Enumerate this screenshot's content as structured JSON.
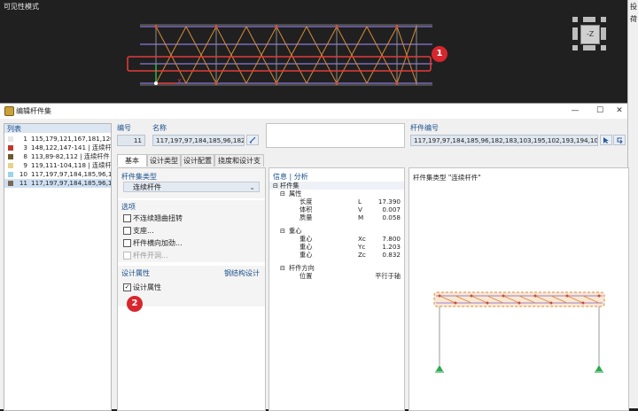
{
  "viewport": {
    "title": "可见性模式",
    "view_cube_label": "-Z",
    "callout1": "1",
    "axis_x": "X"
  },
  "right_strip": {
    "t1": "投",
    "t2": "荷"
  },
  "dialog": {
    "title": "编辑杆件集",
    "win_minimize": "—",
    "win_maximize": "☐",
    "win_close": "✕",
    "list_header": "列表",
    "list": [
      {
        "no": "1",
        "text": "115,179,121,167,181,120,180,9",
        "color": "#e6e6e6"
      },
      {
        "no": "3",
        "text": "148,122,147-141 | 连续杆件",
        "color": "#c0392b"
      },
      {
        "no": "8",
        "text": "113,89-82,112 | 连续杆件",
        "color": "#6b5a2a"
      },
      {
        "no": "9",
        "text": "119,111-104,118 | 连续杆件",
        "color": "#e8d28a"
      },
      {
        "no": "10",
        "text": "117,197,97,184,185,96,182,183,",
        "color": "#9fd3e8"
      },
      {
        "no": "11",
        "text": "117,197,97,184,185,96,182,183,",
        "color": "#7a6a55",
        "selected": true
      }
    ],
    "number_label": "编号",
    "number_value": "11",
    "name_label": "名称",
    "name_value": "117,197,97,184,185,96,182,183,10",
    "members_label": "杆件编号",
    "members_value": "117,197,97,184,185,96,182,183,103,195,102,193,194,101,191,192,100,19",
    "tabs": [
      "基本",
      "设计类型",
      "设计配置",
      "挠度和设计支座"
    ],
    "type_label": "杆件集类型",
    "type_value": "连续杆件",
    "options_label": "选项",
    "options": [
      {
        "label": "不连续翘曲扭转",
        "checked": false,
        "disabled": false
      },
      {
        "label": "支座...",
        "checked": false,
        "disabled": false
      },
      {
        "label": "杆件横向加劲...",
        "checked": false,
        "disabled": false
      },
      {
        "label": "杆件开洞...",
        "checked": false,
        "disabled": true
      }
    ],
    "design_label": "设计属性",
    "design_right": "钢结构设计",
    "design_check_label": "设计属性",
    "design_checked": true,
    "callout2": "2",
    "info_header": "信息 | 分析",
    "info": {
      "root": "杆件集",
      "props_group": "属性",
      "length_name": "长度",
      "length_sym": "L",
      "length_val": "17.390",
      "volume_name": "体积",
      "volume_sym": "V",
      "volume_val": "0.007",
      "mass_name": "质量",
      "mass_sym": "M",
      "mass_val": "0.058",
      "centroid_group": "重心",
      "xc_name": "重心",
      "xc_sym": "Xc",
      "xc_val": "7.800",
      "yc_name": "重心",
      "yc_sym": "Yc",
      "yc_val": "1.203",
      "zc_name": "重心",
      "zc_sym": "Zc",
      "zc_val": "0.832",
      "dir_group": "杆件方向",
      "pos_name": "位置",
      "pos_val": "平行于轴"
    },
    "preview_title": "杆件集类型 \"连续杆件\""
  },
  "colors": {
    "accent": "#1a4f8b",
    "highlight": "#d7262d",
    "truss_orange": "#d88a3a",
    "truss_purple": "#9b7fd0"
  }
}
